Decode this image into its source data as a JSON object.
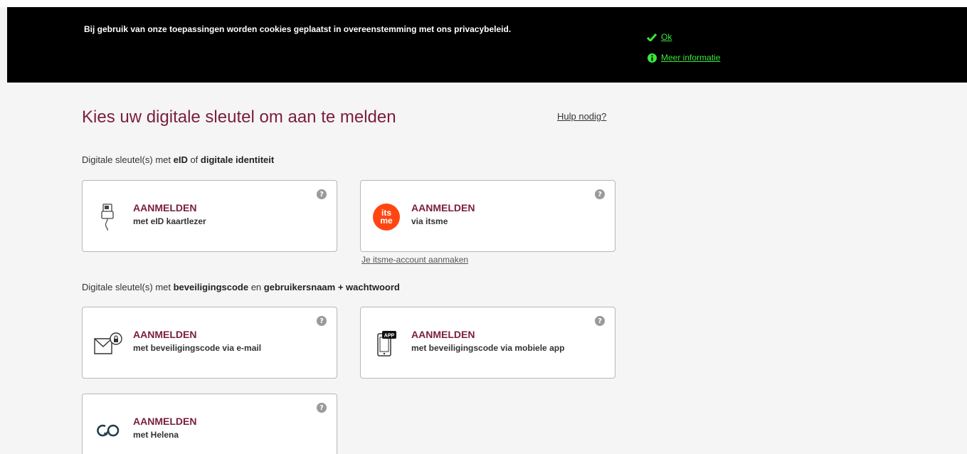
{
  "cookie_banner": {
    "text": "Bij gebruik van onze toepassingen worden cookies geplaatst in overeenstemming met ons privacybeleid.",
    "ok_label": "Ok",
    "more_info_label": "Meer informatie",
    "link_color": "#39e639"
  },
  "page": {
    "title": "Kies uw digitale sleutel om aan te melden",
    "help_label": "Hulp nodig?"
  },
  "section_1": {
    "prefix": "Digitale sleutel(s) met ",
    "b1": "eID",
    "mid": " of ",
    "b2": "digitale identiteit"
  },
  "section_2": {
    "prefix": "Digitale sleutel(s) met ",
    "b1": "beveiligingscode",
    "mid": " en ",
    "b2": "gebruikersnaam + wachtwoord"
  },
  "cards": [
    {
      "title": "AANMELDEN",
      "subtitle": "met eID kaartlezer",
      "icon": "card-reader-icon"
    },
    {
      "title": "AANMELDEN",
      "subtitle": "via itsme",
      "icon": "itsme-logo",
      "logo_top": "its",
      "logo_bottom": "me"
    },
    {
      "title": "AANMELDEN",
      "subtitle": "met beveiligingscode via e-mail",
      "icon": "mail-lock-icon"
    },
    {
      "title": "AANMELDEN",
      "subtitle": "met beveiligingscode via mobiele app",
      "icon": "mobile-app-icon",
      "app_badge": "APP"
    },
    {
      "title": "AANMELDEN",
      "subtitle": "met Helena",
      "icon": "helena-icon"
    }
  ],
  "help_glyph": "?",
  "itsme_create_label": "Je itsme-account aanmaken",
  "colors": {
    "accent": "#7a1e3c",
    "itsme": "#ff4612"
  }
}
